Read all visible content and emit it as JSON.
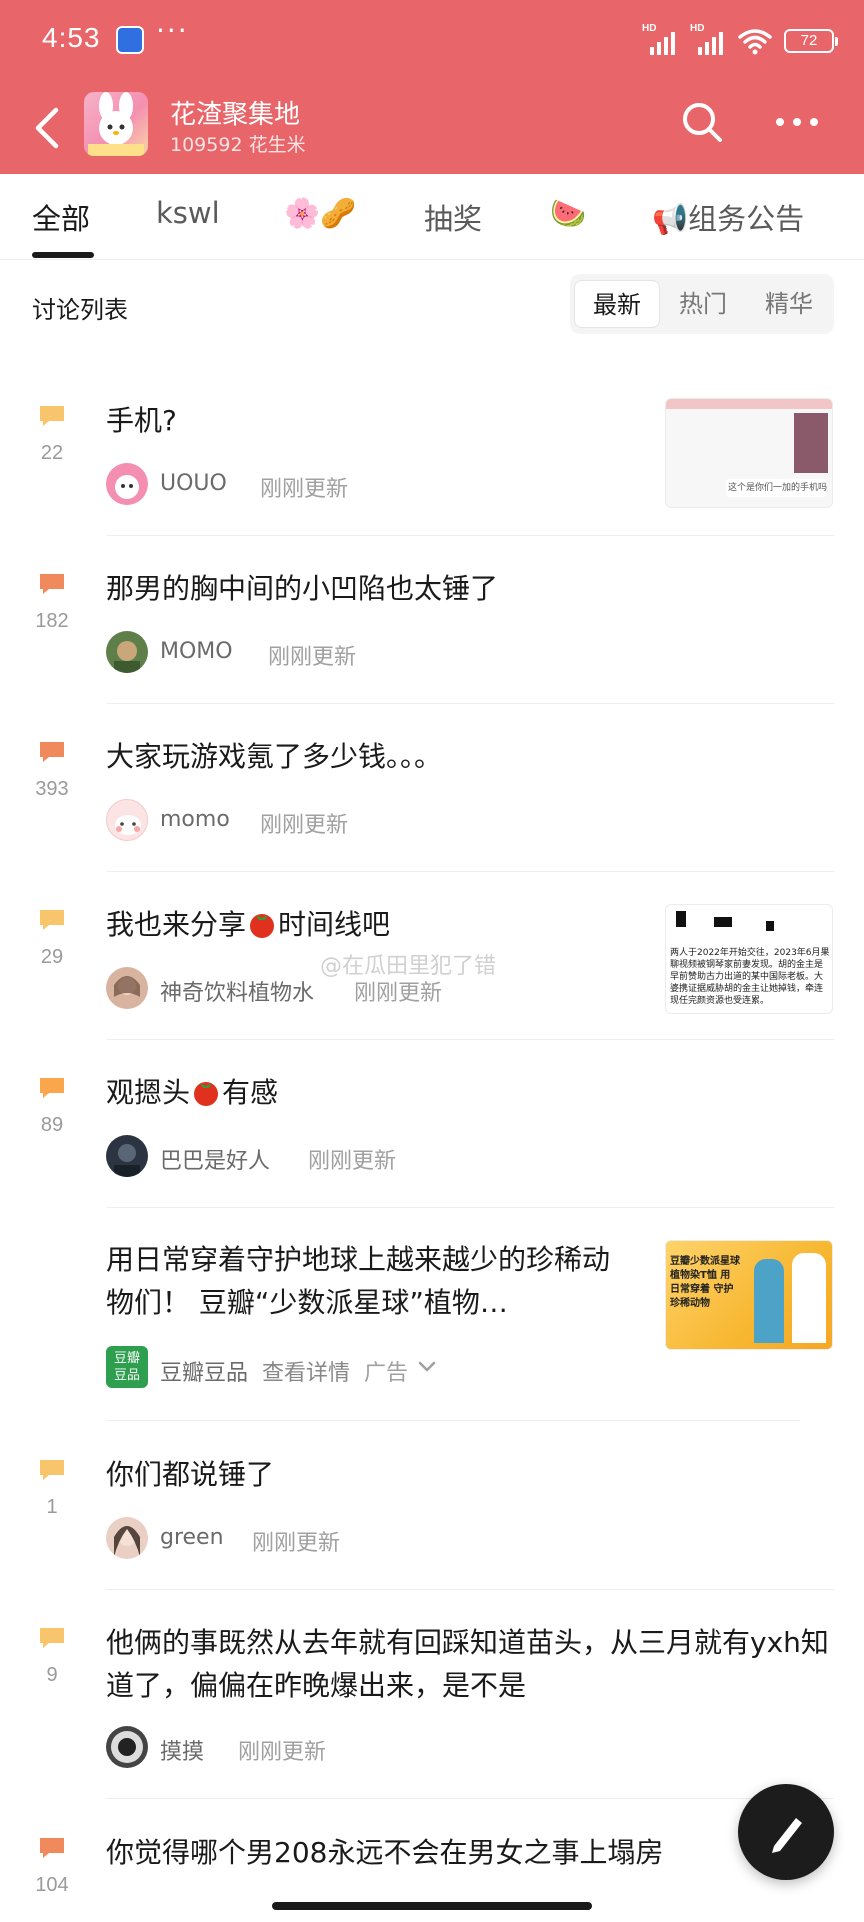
{
  "status_bar": {
    "time": "4:53",
    "more": "···",
    "hd1": "HD",
    "hd2": "HD",
    "battery": "72"
  },
  "header": {
    "group_name": "花渣聚集地",
    "member_line": "109592 花生米"
  },
  "tabs": [
    {
      "label": "全部",
      "active": true
    },
    {
      "label": "kswl"
    },
    {
      "label": "🌸🥜"
    },
    {
      "label": "抽奖"
    },
    {
      "label": "🍉"
    },
    {
      "label": "📢组务公告"
    }
  ],
  "list": {
    "title": "讨论列表",
    "sort": [
      "最新",
      "热门",
      "精华"
    ],
    "active_sort": "最新"
  },
  "posts": [
    {
      "count": "22",
      "title": "手机?",
      "author": "UOUO",
      "time": "刚刚更新",
      "bubble_color": "#f9c56c",
      "thumb_text": "这个是你们一加的手机吗"
    },
    {
      "count": "182",
      "title": "那男的胸中间的小凹陷也太锤了",
      "author": "MOMO",
      "time": "刚刚更新",
      "bubble_color": "#f08a5d"
    },
    {
      "count": "393",
      "title": "大家玩游戏氪了多少钱。。。",
      "author": "momo",
      "time": "刚刚更新",
      "bubble_color": "#f08a5d"
    },
    {
      "count": "29",
      "title_a": "我也来分享",
      "title_b": "时间线吧",
      "author": "神奇饮料植物水",
      "time": "刚刚更新",
      "bubble_color": "#f9c56c",
      "thumb_text": "两人于2022年开始交往，2023年6月果聊视频被钢琴家前妻发现。胡的金主是早前赞助古力出道的某中国际老板。大婆携证据威胁胡的金主让她掉钱，牵连现任完颜资源也受连累。"
    },
    {
      "count": "89",
      "title_a": "观摁头",
      "title_b": "有感",
      "author": "巴巴是好人",
      "time": "刚刚更新",
      "bubble_color": "#f9a64d"
    },
    {
      "ad": true,
      "title": "用日常穿着守护地球上越来越少的珍稀动物们！ 豆瓣“少数派星球”植物…",
      "author": "豆瓣豆品",
      "detail": "查看详情",
      "tag": "广告",
      "logo": "豆瓣\n豆品",
      "thumb_text": "豆瓣少数派星球 植物染T恤 用日常穿着 守护珍稀动物"
    },
    {
      "count": "1",
      "title": "你们都说锤了",
      "author": "green",
      "time": "刚刚更新",
      "bubble_color": "#f9c56c"
    },
    {
      "count": "9",
      "title": "他俩的事既然从去年就有回踩知道苗头，从三月就有yxh知道了，偏偏在昨晚爆出来，是不是",
      "author": "摸摸",
      "time": "刚刚更新",
      "bubble_color": "#f9c56c"
    },
    {
      "count": "104",
      "title": "你觉得哪个男208永远不会在男女之事上塌房",
      "bubble_color": "#f08a5d"
    }
  ],
  "watermark": "@在瓜田里犯了错"
}
